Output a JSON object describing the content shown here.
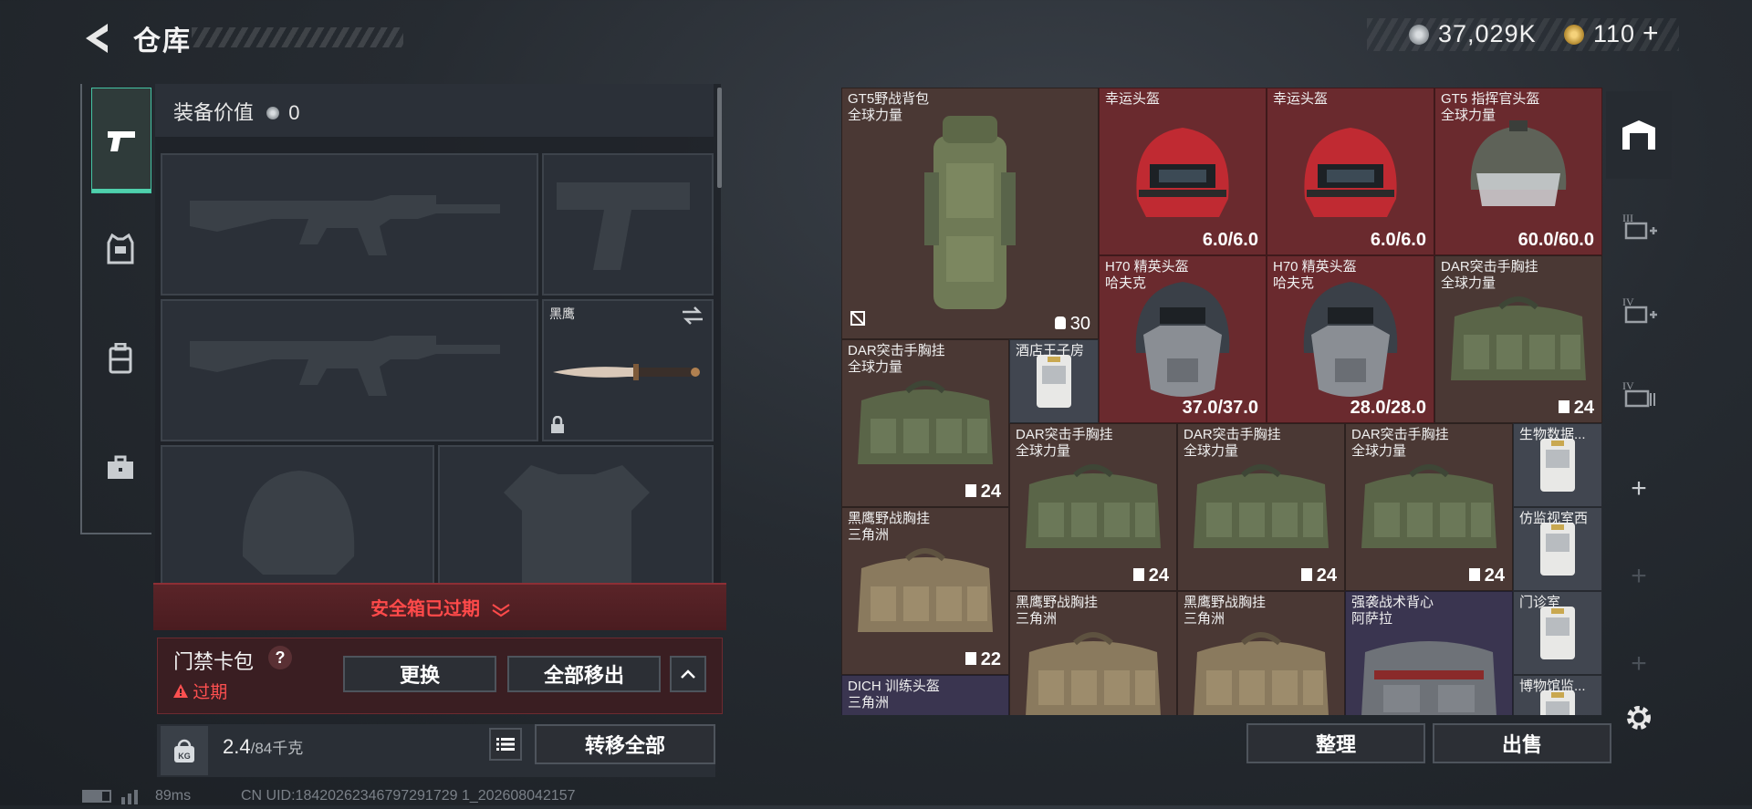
{
  "header": {
    "title": "仓库",
    "currency1": "37,029K",
    "currency2": "110",
    "currency2_plus": "+"
  },
  "equipment": {
    "value_label": "装备价值",
    "value": "0",
    "melee_name": "黑鹰"
  },
  "safebox": {
    "expired_banner": "安全箱已过期",
    "card_pack_label": "门禁卡包",
    "help": "?",
    "expired_status": "过期",
    "replace_button": "更换",
    "remove_all_button": "全部移出"
  },
  "weight": {
    "current": "2.4",
    "max": "/84千克",
    "kg_icon_text": "KG",
    "transfer_all_button": "转移全部"
  },
  "stash": {
    "items": [
      {
        "name": "GT5野战背包",
        "sub": "全球力量",
        "value": "30"
      },
      {
        "name": "幸运头盔",
        "sub": "",
        "value": "6.0/6.0"
      },
      {
        "name": "幸运头盔",
        "sub": "",
        "value": "6.0/6.0"
      },
      {
        "name": "GT5 指挥官头盔",
        "sub": "全球力量",
        "value": "60.0/60.0"
      },
      {
        "name": "H70 精英头盔",
        "sub": "哈夫克",
        "value": "37.0/37.0"
      },
      {
        "name": "H70 精英头盔",
        "sub": "哈夫克",
        "value": "28.0/28.0"
      },
      {
        "name": "DAR突击手胸挂",
        "sub": "全球力量",
        "value": "24"
      },
      {
        "name": "DAR突击手胸挂",
        "sub": "全球力量",
        "value": "24"
      },
      {
        "name": "酒店王子房",
        "sub": "",
        "value": ""
      },
      {
        "name": "DAR突击手胸挂",
        "sub": "全球力量",
        "value": "24"
      },
      {
        "name": "DAR突击手胸挂",
        "sub": "全球力量",
        "value": "24"
      },
      {
        "name": "DAR突击手胸挂",
        "sub": "全球力量",
        "value": "24"
      },
      {
        "name": "生物数据...",
        "sub": "",
        "value": ""
      },
      {
        "name": "黑鹰野战胸挂",
        "sub": "三角洲",
        "value": "22"
      },
      {
        "name": "仿监视室西",
        "sub": "",
        "value": ""
      },
      {
        "name": "黑鹰野战胸挂",
        "sub": "三角洲",
        "value": ""
      },
      {
        "name": "黑鹰野战胸挂",
        "sub": "三角洲",
        "value": ""
      },
      {
        "name": "强袭战术背心",
        "sub": "阿萨拉",
        "value": ""
      },
      {
        "name": "门诊室",
        "sub": "",
        "value": ""
      },
      {
        "name": "DICH 训练头盔",
        "sub": "三角洲",
        "value": ""
      },
      {
        "name": "博物馆监...",
        "sub": "",
        "value": ""
      }
    ],
    "sort_button": "整理",
    "sell_button": "出售"
  },
  "status_bar": {
    "ping": "89ms",
    "uid": "CN UID:18420262346797291729 1_202608042157"
  },
  "colors": {
    "accent": "#4fd0ac",
    "expired_red": "#ff4a4a",
    "cell_red": "#6a2a2e",
    "cell_brown": "#4a3834"
  }
}
